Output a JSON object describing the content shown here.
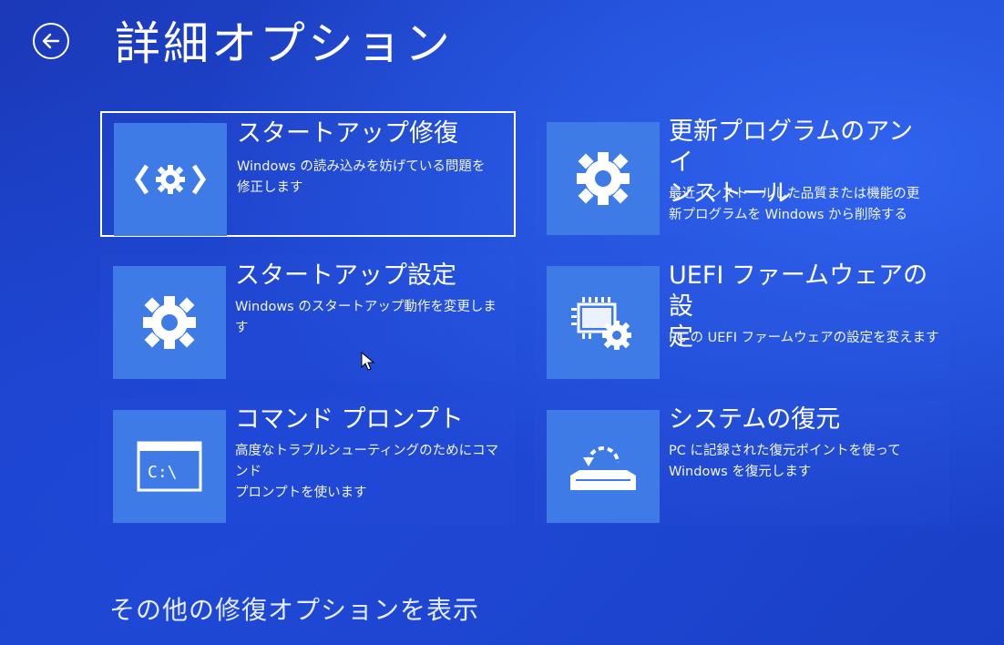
{
  "header": {
    "title": "詳細オプション"
  },
  "options": [
    {
      "title": "スタートアップ修復",
      "description": "Windows の読み込みを妨げている問題を\n修正します",
      "icon": "startup-repair-icon"
    },
    {
      "title": "更新プログラムのアン イ\nンストール",
      "description": "最近インストールした品質または機能の更\n新プログラムを Windows から削除する",
      "icon": "gear-icon"
    },
    {
      "title": "スタートアップ設定",
      "description": "Windows のスタートアップ動作を変更しま\nす",
      "icon": "gear-icon"
    },
    {
      "title": "UEFI ファームウェアの設\n定",
      "description": "PC の UEFI ファームウェアの設定を変えます",
      "icon": "firmware-icon"
    },
    {
      "title": "コマンド プロンプト",
      "description": "高度なトラブルシューティングのためにコマンド\nプロンプトを使います",
      "icon": "command-prompt-icon"
    },
    {
      "title": "システムの復元",
      "description": "PC に記録された復元ポイントを使って\nWindows を復元します",
      "icon": "system-restore-icon"
    }
  ],
  "footer": {
    "more_options_link": "その他の修復オプションを表示"
  },
  "colors": {
    "background": "#1e45cf",
    "tile": "#3e7be6",
    "text": "#ffffff"
  }
}
